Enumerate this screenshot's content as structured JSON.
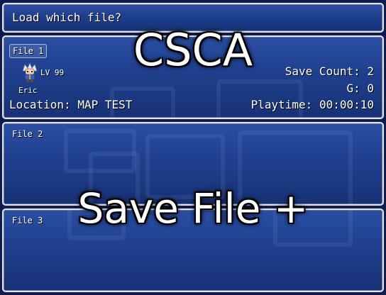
{
  "help_window": {
    "text": "Load which file?"
  },
  "save_files": [
    {
      "label": "File 1",
      "selected": true,
      "character": {
        "name": "Eric",
        "level": "LV 99",
        "sprite_icon": "hero-sprite-icon"
      },
      "location": "Location: MAP TEST",
      "save_count": "Save Count: 2",
      "gold": "G: 0",
      "playtime": "Playtime: 00:00:10"
    },
    {
      "label": "File 2",
      "selected": false
    },
    {
      "label": "File 3",
      "selected": false
    }
  ],
  "overlay": {
    "title": "CSCA",
    "subtitle": "Save File +"
  },
  "colors": {
    "window_top": "#2a4fa3",
    "window_bottom": "#173174",
    "window_border": "#dfe4ee",
    "background": "#0e1a52",
    "text": "#ffffff"
  }
}
